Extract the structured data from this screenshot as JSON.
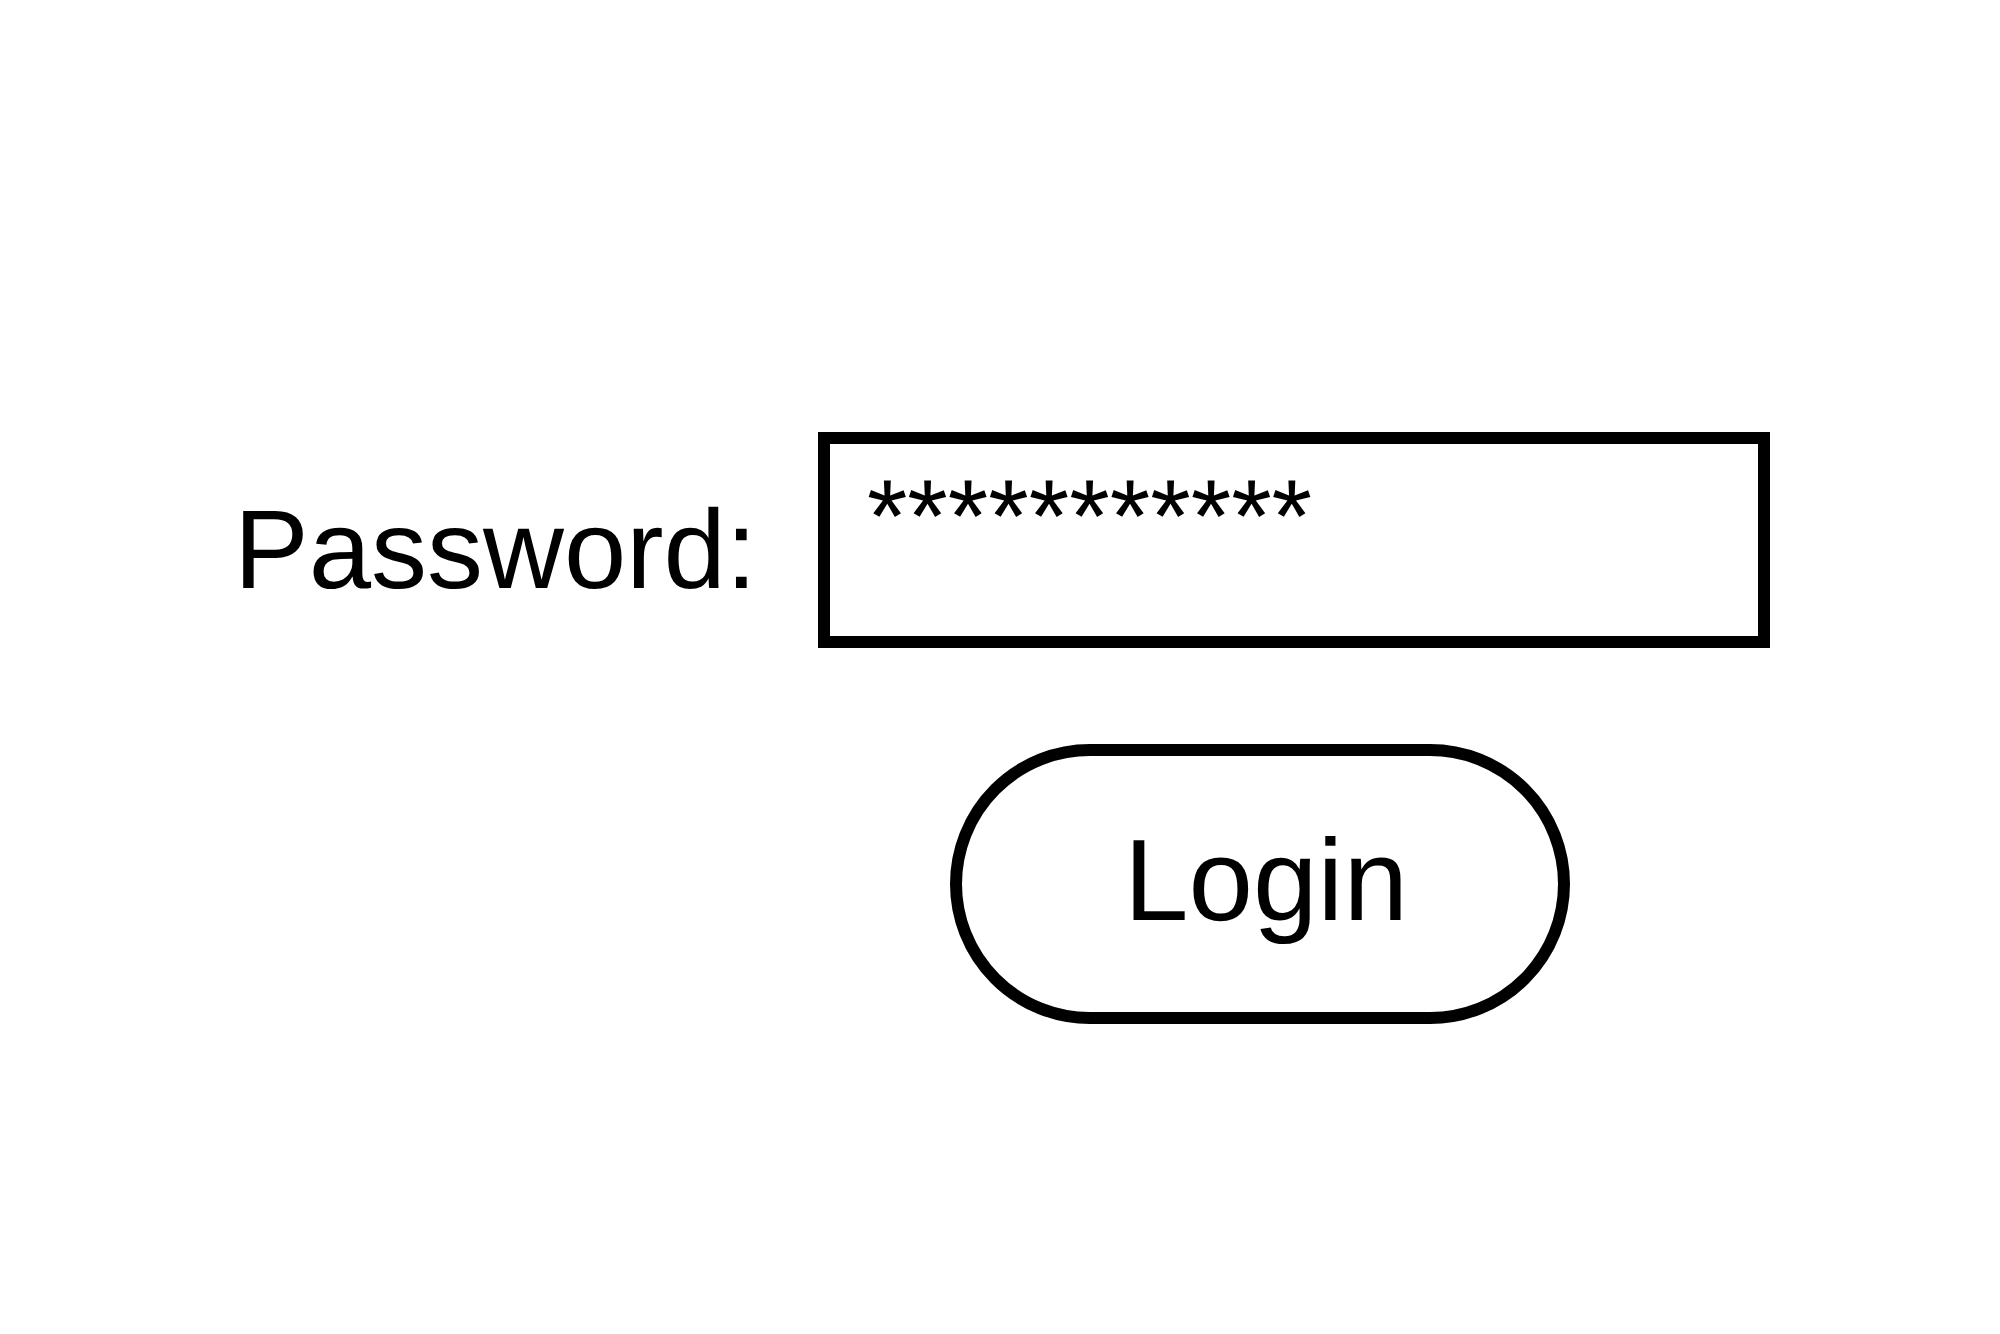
{
  "form": {
    "password": {
      "label": "Password:",
      "value": "***********"
    },
    "login_button": {
      "label": "Login"
    }
  }
}
